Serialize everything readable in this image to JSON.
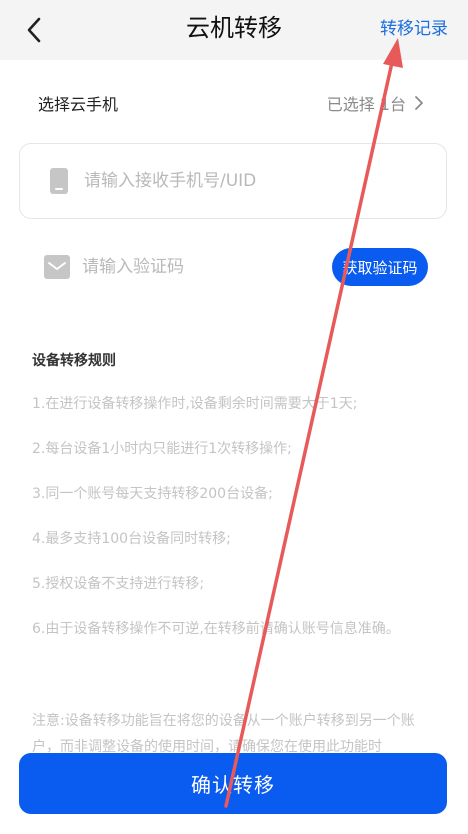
{
  "header": {
    "title": "云机转移",
    "history_link": "转移记录"
  },
  "select": {
    "label": "选择云手机",
    "value": "已选择 1台"
  },
  "phone_input": {
    "placeholder": "请输入接收手机号/UID",
    "value": ""
  },
  "code_input": {
    "placeholder": "请输入验证码",
    "value": "",
    "button_label": "获取验证码"
  },
  "rules": {
    "title": "设备转移规则",
    "items": [
      "1.在进行设备转移操作时,设备剩余时间需要大于1天;",
      "2.每台设备1小时内只能进行1次转移操作;",
      "3.同一个账号每天支持转移200台设备;",
      "4.最多支持100台设备同时转移;",
      "5.授权设备不支持进行转移;",
      "6.由于设备转移操作不可逆,在转移前请确认账号信息准确。"
    ],
    "note": "注意:设备转移功能旨在将您的设备从一个账户转移到另一个账户，而非调整设备的使用时间，请确保您在使用此功能时"
  },
  "confirm_button": "确认转移",
  "colors": {
    "accent": "#0a5bf0",
    "link": "#1a6ee0",
    "annotation_arrow": "#e85a5a"
  },
  "icons": {
    "back": "chevron-left-icon",
    "select_arrow": "chevron-right-icon",
    "phone": "phone-icon",
    "code": "envelope-icon"
  }
}
